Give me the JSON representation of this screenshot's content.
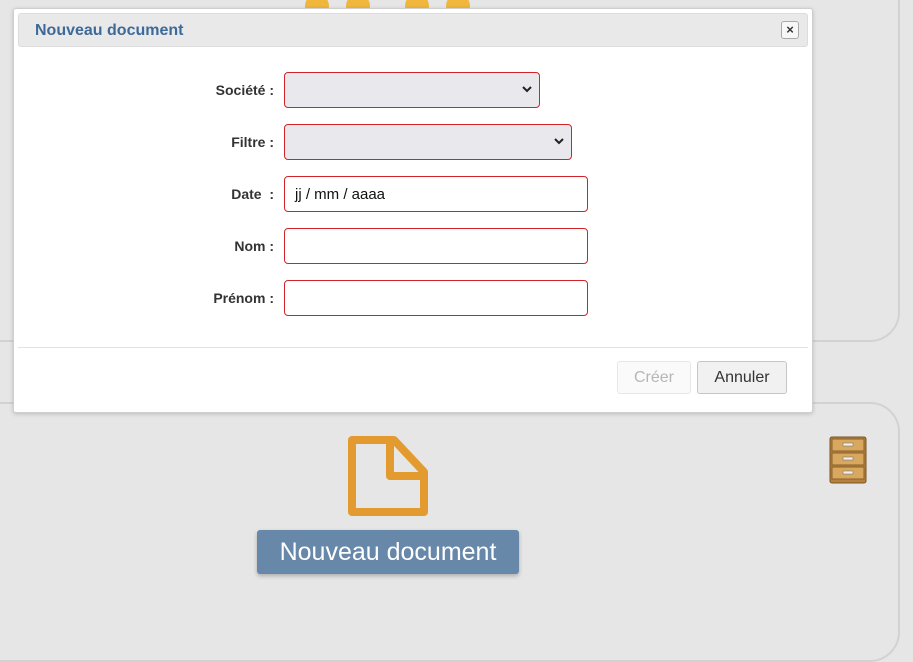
{
  "dialog": {
    "title": "Nouveau document",
    "close_icon": "close-icon",
    "fields": {
      "societe": {
        "label": "Société :",
        "value": ""
      },
      "filtre": {
        "label": "Filtre :",
        "value": ""
      },
      "date": {
        "label": "Date  :",
        "value": "jj / mm / aaaa"
      },
      "nom": {
        "label": "Nom :",
        "value": ""
      },
      "prenom": {
        "label": "Prénom :",
        "value": ""
      }
    },
    "buttons": {
      "create": "Créer",
      "cancel": "Annuler"
    }
  },
  "main": {
    "new_document_button": "Nouveau document",
    "document_icon": "document-icon",
    "cabinet_icon": "filing-cabinet-icon"
  },
  "colors": {
    "title": "#3d6a98",
    "field_border": "#d3232a",
    "primary_button": "#6788a9",
    "document_icon": "#e39b2f"
  }
}
